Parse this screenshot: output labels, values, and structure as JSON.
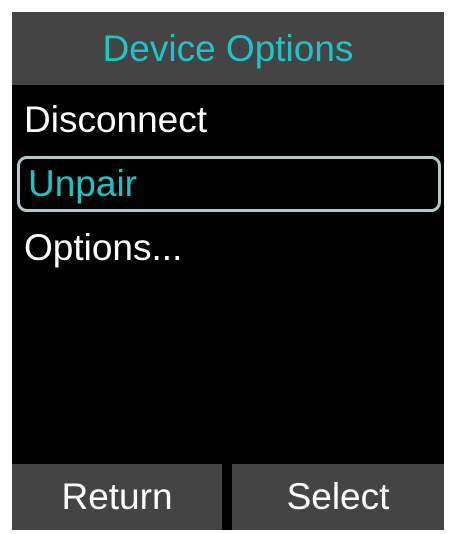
{
  "header": {
    "title": "Device Options"
  },
  "menu": {
    "items": [
      {
        "label": "Disconnect"
      },
      {
        "label": "Unpair"
      },
      {
        "label": "Options..."
      }
    ],
    "selected_index": 1
  },
  "softkeys": {
    "left_label": "Return",
    "right_label": "Select"
  },
  "colors": {
    "accent": "#1cc5c5",
    "bar_background": "#444444",
    "screen_background": "#000000",
    "selection_border": "#b5c8c8"
  }
}
